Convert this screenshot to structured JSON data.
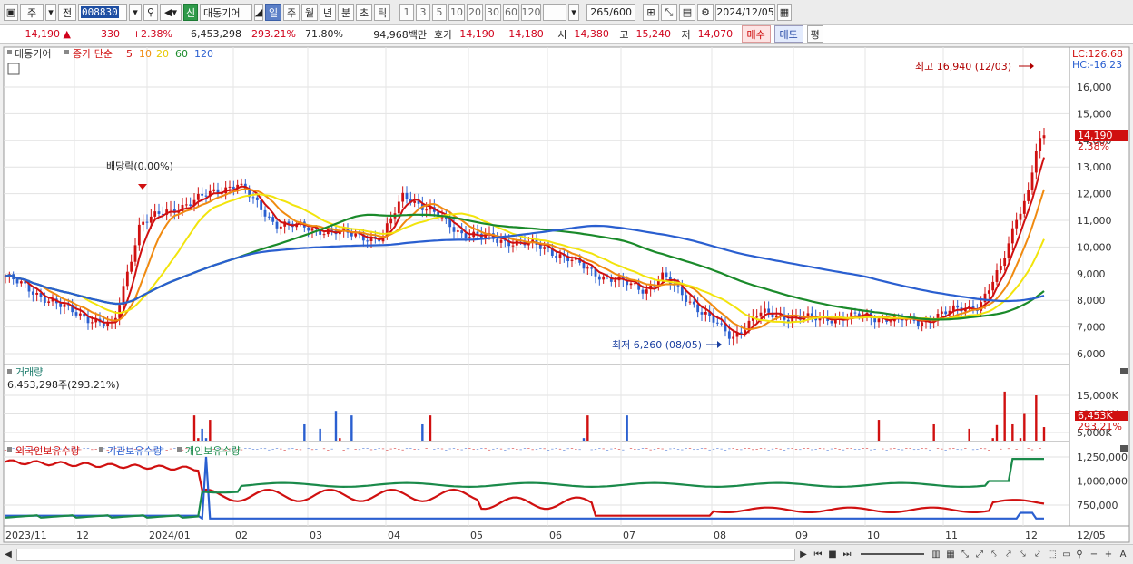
{
  "toolbar": {
    "market": "주",
    "prev": "전",
    "code": "008830",
    "badge": "신",
    "stock_name": "대동기어",
    "periods": [
      "일",
      "주",
      "월",
      "년",
      "분",
      "초",
      "틱"
    ],
    "active_period": "일",
    "intervals": [
      "1",
      "3",
      "5",
      "10",
      "20",
      "30",
      "60",
      "120"
    ],
    "count": "265",
    "count_max": "/600",
    "date": "2024/12/05"
  },
  "quote": {
    "price": "14,190",
    "change": "330",
    "change_pct": "+2.38%",
    "volume": "6,453,298",
    "volume_ratio": "293.21%",
    "turnover": "71.80%",
    "amount": "94,968백만",
    "bid_label": "호가",
    "ask": "14,190",
    "bid": "14,180",
    "open_label": "시",
    "open": "14,380",
    "high_label": "고",
    "high": "15,240",
    "low_label": "저",
    "low": "14,070",
    "buy_button": "매수",
    "sell_button": "매도",
    "eval_button": "평"
  },
  "price_pane": {
    "title": "대동기어",
    "ma_label": "종가 단순",
    "ma_periods": [
      "5",
      "10",
      "20",
      "60",
      "120"
    ],
    "ma_colors": [
      "#d01010",
      "#f08a10",
      "#f2e40c",
      "#1a8a2a",
      "#2a5fd0"
    ],
    "lc": "LC:126.68",
    "hc": "HC:-16.23",
    "high_annotation": "최고 16,940 (12/03)",
    "low_annotation": "최저 6,260 (08/05)",
    "dividend_label": "배당락(0.00%)",
    "current_price_tag": "14,190",
    "current_pct_tag": "2.38%",
    "y_ticks": [
      "16,000",
      "15,000",
      "14,000",
      "13,000",
      "12,000",
      "11,000",
      "10,000",
      "9,000",
      "8,000",
      "7,000",
      "6,000"
    ]
  },
  "volume_pane": {
    "title": "거래량",
    "value": "6,453,298주(293.21%)",
    "y_ticks": [
      "15,000K",
      "10,000K",
      "5,000K"
    ],
    "current_tag": "6,453K",
    "current_pct": "293.21%"
  },
  "holding_pane": {
    "series_names": [
      "외국인보유수량",
      "기관보유수량",
      "개인보유수량"
    ],
    "series_colors": [
      "#d01010",
      "#2a5fd0",
      "#1a8a4a"
    ],
    "y_ticks": [
      "1,250,000",
      "1,000,000",
      "750,000"
    ]
  },
  "x_axis": {
    "labels": [
      "2023/11",
      "12",
      "2024/01",
      "02",
      "03",
      "04",
      "05",
      "06",
      "07",
      "08",
      "09",
      "10",
      "11",
      "12",
      "12/05"
    ]
  }
}
